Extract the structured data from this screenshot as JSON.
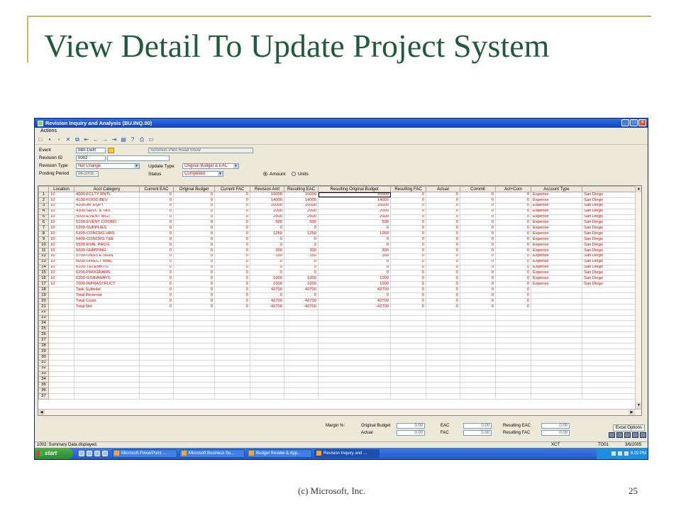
{
  "slide": {
    "title": "View Detail To Update Project System",
    "footer_center": "(c) Microsoft, Inc.",
    "page_number": "25",
    "accent_color": "#1f5a3a",
    "decoration_color": "#c9b36a"
  },
  "window": {
    "title": "Revision Inquiry and Analysis (BU.INQ.00)",
    "menu": [
      "Actions"
    ],
    "toolbar_icons": [
      "new-icon",
      "save-icon",
      "copy-icon",
      "delete-icon",
      "cut-icon",
      "first-icon",
      "prev-icon",
      "next-icon",
      "last-icon",
      "list-icon",
      "help-icon",
      "print-icon",
      "screen-icon"
    ]
  },
  "form": {
    "event_label": "Event",
    "event_value": "080-1500",
    "event_desc": "Solomon PMA Road Show",
    "revision_id_label": "Revision ID",
    "revision_id_value": "0002",
    "revision_type_label": "Revision Type",
    "revision_type_value": "Net Change",
    "posting_period_label": "Posting Period",
    "posting_period_value": "08-2005",
    "update_type_label": "Update Type",
    "update_type_value": "Original Budget & EAC",
    "status_label": "Status",
    "status_value": "Completed",
    "amount_label": "Amount",
    "units_label": "Units"
  },
  "grid": {
    "headers": [
      "",
      "Location",
      "Acct Category",
      "Current EAC",
      "Original Budget",
      "Current FAC",
      "Revision Amt",
      "Resulting EAC",
      "Resulting Original Budget",
      "Resulting FAC",
      "Actual",
      "Commit",
      "Act+Com",
      "Account Type",
      ""
    ],
    "rows": [
      [
        "1",
        "10",
        "4000-FCLTY RNTL",
        "0",
        "0",
        "0",
        "10000",
        "10000",
        "10000",
        "0",
        "0",
        "0",
        "0",
        "Expense",
        "San Diego"
      ],
      [
        "2",
        "10",
        "4100-FOOD BEV",
        "0",
        "0",
        "0",
        "14000",
        "14000",
        "14000",
        "0",
        "0",
        "0",
        "0",
        "Expense",
        "San Diego"
      ],
      [
        "3",
        "10",
        "4200-AV EQPT",
        "0",
        "0",
        "0",
        "10000",
        "10000",
        "10000",
        "0",
        "0",
        "0",
        "0",
        "Expense",
        "San Diego"
      ],
      [
        "4",
        "10",
        "4300-SRVC & TAX",
        "0",
        "0",
        "0",
        "2000",
        "2000",
        "2000",
        "0",
        "0",
        "0",
        "0",
        "Expense",
        "San Diego"
      ],
      [
        "5",
        "10",
        "5000-EVENT MGT",
        "0",
        "0",
        "0",
        "2500",
        "2500",
        "2500",
        "0",
        "0",
        "0",
        "0",
        "Expense",
        "San Diego"
      ],
      [
        "6",
        "10",
        "5100-EVENT COORD",
        "0",
        "0",
        "0",
        "500",
        "500",
        "500",
        "0",
        "0",
        "0",
        "0",
        "Expense",
        "San Diego"
      ],
      [
        "7",
        "10",
        "5200-SUPPLIES",
        "0",
        "0",
        "0",
        "0",
        "0",
        "0",
        "0",
        "0",
        "0",
        "0",
        "Expense",
        "San Diego"
      ],
      [
        "8",
        "10",
        "5300-CONCRG HRS",
        "0",
        "0",
        "0",
        "1250",
        "1250",
        "1250",
        "0",
        "0",
        "0",
        "0",
        "Expense",
        "San Diego"
      ],
      [
        "9",
        "10",
        "5400-CONCRG T&E",
        "0",
        "0",
        "0",
        "0",
        "0",
        "0",
        "0",
        "0",
        "0",
        "0",
        "Expense",
        "San Diego"
      ],
      [
        "10",
        "10",
        "5500-EVAL PRCG",
        "0",
        "0",
        "0",
        "0",
        "0",
        "0",
        "0",
        "0",
        "0",
        "0",
        "Expense",
        "San Diego"
      ],
      [
        "11",
        "10",
        "5600-SHIPPING",
        "0",
        "0",
        "0",
        "300",
        "300",
        "300",
        "0",
        "0",
        "0",
        "0",
        "Expense",
        "San Diego"
      ],
      [
        "12",
        "10",
        "5700-ONSITE SIGN",
        "0",
        "0",
        "0",
        "150",
        "150",
        "150",
        "0",
        "0",
        "0",
        "0",
        "Expense",
        "San Diego"
      ],
      [
        "13",
        "10",
        "6000-DIRECT MAIL",
        "0",
        "0",
        "0",
        "0",
        "0",
        "0",
        "0",
        "0",
        "0",
        "0",
        "Expense",
        "San Diego"
      ],
      [
        "14",
        "10",
        "6100-TELEMKTG",
        "0",
        "0",
        "0",
        "0",
        "0",
        "0",
        "0",
        "0",
        "0",
        "0",
        "Expense",
        "San Diego"
      ],
      [
        "15",
        "10",
        "6200-PROGRAMS",
        "0",
        "0",
        "0",
        "0",
        "0",
        "0",
        "0",
        "0",
        "0",
        "0",
        "Expense",
        "San Diego"
      ],
      [
        "16",
        "10",
        "6300-GIVEAWAYS",
        "0",
        "0",
        "0",
        "1000",
        "1000",
        "1000",
        "0",
        "0",
        "0",
        "0",
        "Expense",
        "San Diego"
      ],
      [
        "17",
        "10",
        "7000-INFRASTRUCT",
        "0",
        "0",
        "0",
        "1000",
        "1000",
        "1000",
        "0",
        "0",
        "0",
        "0",
        "Expense",
        "San Diego"
      ],
      [
        "18",
        "",
        "Task Subtotal",
        "0",
        "0",
        "0",
        "42700",
        "42700",
        "42700",
        "0",
        "0",
        "0",
        "0",
        "",
        ""
      ],
      [
        "19",
        "",
        "Total Revenue",
        "0",
        "0",
        "0",
        "0",
        "0",
        "0",
        "0",
        "0",
        "0",
        "0",
        "",
        ""
      ],
      [
        "20",
        "",
        "Total Costs",
        "0",
        "0",
        "0",
        "42700",
        "42700",
        "42700",
        "0",
        "0",
        "0",
        "0",
        "",
        ""
      ],
      [
        "21",
        "",
        "Total Net",
        "0",
        "0",
        "0",
        "-42700",
        "-42700",
        "-42700",
        "0",
        "0",
        "0",
        "0",
        "",
        ""
      ]
    ],
    "empty_row_numbers": [
      "22",
      "23",
      "24",
      "25",
      "26",
      "27",
      "28",
      "29",
      "30",
      "31",
      "32",
      "33",
      "34",
      "35",
      "36",
      "37"
    ]
  },
  "summary": {
    "margin_label": "Margin %:",
    "original_budget_label": "Original Budget",
    "original_budget_value": "0.00",
    "actual_label": "Actual",
    "actual_value": "0.00",
    "eac_label": "EAC",
    "eac_value": "0.00",
    "fac_label": "FAC",
    "fac_value": "0.00",
    "resulting_eac_label": "Resulting EAC",
    "resulting_eac_value": "0.00",
    "resulting_fac_label": "Resulting FAC",
    "resulting_fac_value": "0.00",
    "excel_button": "Excel Options"
  },
  "statusbar": {
    "message": "1002: Summary Data displayed.",
    "user": "XCT",
    "company": "TO01",
    "date": "3/6/2005"
  },
  "taskbar": {
    "start": "start",
    "tasks": [
      "Microsoft PowerPoint ...",
      "Microsoft Business So...",
      "Budget Review & App...",
      "Revision Inquiry and ..."
    ],
    "clock": "8:29 PM"
  }
}
